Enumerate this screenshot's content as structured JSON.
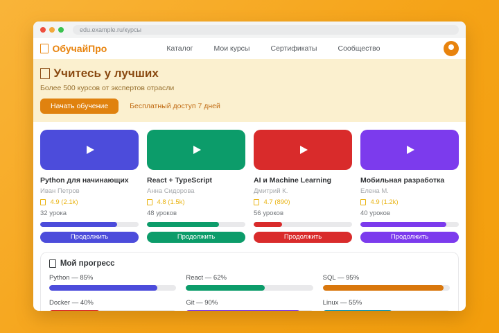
{
  "browser": {
    "url": "edu.example.ru/курсы",
    "traffic_lights": {
      "close": "#EE4F3F",
      "minimize": "#F2A93B",
      "maximize": "#3BC24F"
    }
  },
  "header": {
    "logo": {
      "icon": "missing-glyph-box",
      "label": "ОбучайПро",
      "color": "#E8830D"
    },
    "nav": [
      {
        "label": "Каталог"
      },
      {
        "label": "Мои курсы"
      },
      {
        "label": "Сертификаты"
      },
      {
        "label": "Сообщество"
      }
    ],
    "avatar_icon": "user-avatar"
  },
  "hero": {
    "icon": "missing-glyph-box",
    "title": "Учитесь у лучших",
    "subtitle": "Более 500 курсов от экспертов отрасли",
    "cta_label": "Начать обучение",
    "note": "Бесплатный доступ 7 дней",
    "background": "#FBF0CF"
  },
  "courses": [
    {
      "title": "Python для начинающих",
      "author": "Иван Петров",
      "rating_icon": "star-missing-glyph",
      "rating": "4.9 (2.1k)",
      "lessons": "32 урока",
      "progress": 78,
      "color": "#4C4CDB",
      "button": "Продолжить"
    },
    {
      "title": "React + TypeScript",
      "author": "Анна Сидорова",
      "rating_icon": "star-missing-glyph",
      "rating": "4.8 (1.5k)",
      "lessons": "48 уроков",
      "progress": 73,
      "color": "#0C9C6A",
      "button": "Продолжить"
    },
    {
      "title": "AI и Machine Learning",
      "author": "Дмитрий К.",
      "rating_icon": "star-missing-glyph",
      "rating": "4.7 (890)",
      "lessons": "56 уроков",
      "progress": 29,
      "color": "#D92B2B",
      "button": "Продолжить"
    },
    {
      "title": "Мобильная разработка",
      "author": "Елена М.",
      "rating_icon": "star-missing-glyph",
      "rating": "4.9 (1.2k)",
      "lessons": "40 уроков",
      "progress": 87,
      "color": "#7C3BED",
      "button": "Продолжить"
    }
  ],
  "progress_section": {
    "icon": "missing-glyph-box",
    "title": "Мой прогресс",
    "items": [
      {
        "label": "Python — 85%",
        "value": 85,
        "color": "#4C4CDB"
      },
      {
        "label": "React — 62%",
        "value": 62,
        "color": "#0C9C6A"
      },
      {
        "label": "SQL — 95%",
        "value": 95,
        "color": "#D9770C"
      },
      {
        "label": "Docker — 40%",
        "value": 40,
        "color": "#D92B2B"
      },
      {
        "label": "Git — 90%",
        "value": 90,
        "color": "#7C3BED"
      },
      {
        "label": "Linux — 55%",
        "value": 55,
        "color": "#0F97B6"
      }
    ]
  },
  "chart_data": {
    "type": "bar",
    "title": "Мой прогресс",
    "categories": [
      "Python",
      "React",
      "SQL",
      "Docker",
      "Git",
      "Linux"
    ],
    "values": [
      85,
      62,
      95,
      40,
      90,
      55
    ],
    "ylim": [
      0,
      100
    ]
  }
}
